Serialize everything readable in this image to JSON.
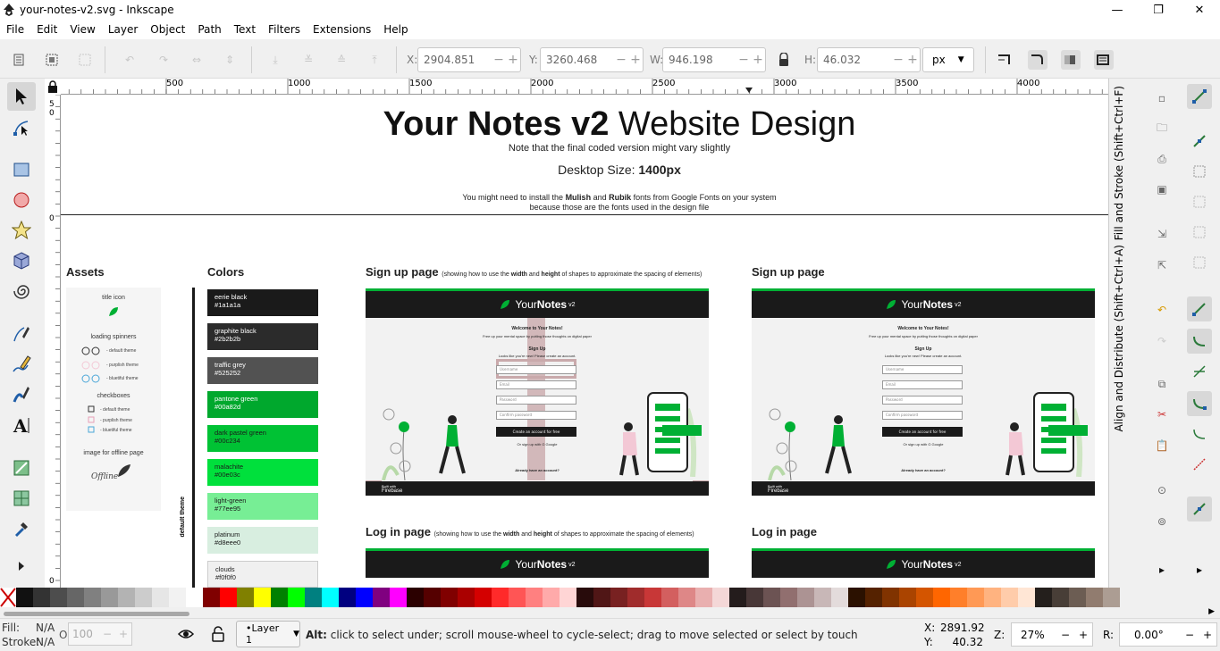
{
  "window": {
    "title": "your-notes-v2.svg - Inkscape",
    "minimize": "—",
    "maximize": "❐",
    "close": "✕"
  },
  "menu": [
    "File",
    "Edit",
    "View",
    "Layer",
    "Object",
    "Path",
    "Text",
    "Filters",
    "Extensions",
    "Help"
  ],
  "toolbar": {
    "x_label": "X:",
    "x_value": "2904.851",
    "y_label": "Y:",
    "y_value": "3260.468",
    "w_label": "W:",
    "w_value": "946.198",
    "h_label": "H:",
    "h_value": "46.032",
    "unit": "px",
    "minus": "−",
    "plus": "+"
  },
  "ruler": {
    "labels": [
      "500",
      "1000",
      "1500",
      "2000",
      "2500",
      "3000",
      "3500",
      "4000"
    ],
    "left_labels": [
      "5",
      "0",
      "0",
      "0"
    ]
  },
  "canvas": {
    "heading_bold": "Your Notes v2",
    "heading_rest": " Website Design",
    "note": "Note that the final coded version might vary slightly",
    "desktop_prefix": "Desktop Size: ",
    "desktop_value": "1400px",
    "fonts_line1_pre": "You might need to install the ",
    "font_a": "Mulish",
    "fonts_and": " and ",
    "font_b": "Rubik",
    "fonts_line1_post": " fonts from Google Fonts on your system",
    "fonts_line2": "because those are the fonts used in the design file",
    "assets_title": "Assets",
    "colors_title": "Colors",
    "assets": {
      "title_icon": "title icon",
      "loading_spinners": "loading spinners",
      "spinner_items": [
        "- default theme",
        "- purplish theme",
        "- bluetiful theme"
      ],
      "checkboxes": "checkboxes",
      "checkbox_items": [
        "- default theme",
        "- purplish theme",
        "- bluetiful theme"
      ],
      "offline_label": "image for offline page",
      "offline_word": "Offline"
    },
    "default_theme_label": "default theme",
    "colors": [
      {
        "name": "eerie black",
        "hex": "#1a1a1a",
        "bg": "#1a1a1a",
        "fg": "#ffffff"
      },
      {
        "name": "graphite black",
        "hex": "#2b2b2b",
        "bg": "#2b2b2b",
        "fg": "#ffffff"
      },
      {
        "name": "traffic grey",
        "hex": "#525252",
        "bg": "#525252",
        "fg": "#ffffff"
      },
      {
        "name": "pantone green",
        "hex": "#00a82d",
        "bg": "#00a82d",
        "fg": "#ffffff"
      },
      {
        "name": "dark pastel green",
        "hex": "#00c234",
        "bg": "#00c234",
        "fg": "#1a1a1a"
      },
      {
        "name": "malachite",
        "hex": "#00e03c",
        "bg": "#00e03c",
        "fg": "#1a1a1a"
      },
      {
        "name": "light-green",
        "hex": "#77ee95",
        "bg": "#77ee95",
        "fg": "#1a1a1a"
      },
      {
        "name": "platinum",
        "hex": "#d8eee0",
        "bg": "#d8eee0",
        "fg": "#1a1a1a"
      },
      {
        "name": "clouds",
        "hex": "#f0f0f0",
        "bg": "#f0f0f0",
        "fg": "#1a1a1a"
      }
    ],
    "signup_title": "Sign up page",
    "login_title": "Log in page",
    "spacing_note_pre": "(showing how to use the ",
    "spacing_width": "width",
    "spacing_and": " and ",
    "spacing_height": "height",
    "spacing_note_post": " of shapes to approximate the spacing of elements)",
    "mock": {
      "brand_pre": "Your ",
      "brand_bold": "Notes",
      "brand_v": " v2",
      "welcome": "Welcome to Your Notes!",
      "tagline": "Free up your mental space by putting those thoughts on digital paper",
      "signup": "Sign Up",
      "new_here": "Looks like you're new! Please create an account.",
      "fields": [
        "Username",
        "Email",
        "Password",
        "Confirm password"
      ],
      "create_btn": "Create an account for free",
      "or_google": "Or sign up with  G  Google",
      "already": "Already have an account?",
      "built_with": "Built with",
      "firebase": "Firebase"
    }
  },
  "status": {
    "fill_label": "Fill:",
    "fill_value": "N/A",
    "stroke_label": "Stroke:",
    "stroke_value": "N/A",
    "opacity_label": "O:",
    "opacity_value": "100",
    "layer": "•Layer 1",
    "message_bold": "Alt:",
    "message": " click to select under; scroll mouse-wheel to cycle-select; drag to move selected or select by touch",
    "x_label": "X:",
    "x_value": "2891.92",
    "y_label": "Y:",
    "y_value": "40.32",
    "z_label": "Z:",
    "zoom": "27%",
    "r_label": "R:",
    "rotation": "0.00°"
  },
  "docks": {
    "fill_stroke": "Fill and Stroke (Shift+Ctrl+F)",
    "align": "Align and Distribute (Shift+Ctrl+A)"
  },
  "palette": [
    "#111111",
    "#333333",
    "#4d4d4d",
    "#666666",
    "#808080",
    "#999999",
    "#b3b3b3",
    "#cccccc",
    "#e6e6e6",
    "#f2f2f2",
    "#ffffff",
    "#800000",
    "#ff0000",
    "#808000",
    "#ffff00",
    "#008000",
    "#00ff00",
    "#008080",
    "#00ffff",
    "#000080",
    "#0000ff",
    "#800080",
    "#ff00ff",
    "#2b0000",
    "#550000",
    "#800000",
    "#aa0000",
    "#d40000",
    "#ff2a2a",
    "#ff5555",
    "#ff8080",
    "#ffaaaa",
    "#ffd5d5",
    "#280b0b",
    "#501616",
    "#782121",
    "#a02c2c",
    "#c83737",
    "#d35f5f",
    "#de8787",
    "#e9afaf",
    "#f4d7d7",
    "#241c1c",
    "#483737",
    "#6c5353",
    "#916f6f",
    "#ac9393",
    "#c8b7b7",
    "#e3dbdb",
    "#2b1100",
    "#552200",
    "#803300",
    "#aa4400",
    "#d45500",
    "#ff6600",
    "#ff7f2a",
    "#ff9955",
    "#ffb380",
    "#ffccaa",
    "#ffe6d5",
    "#241f1c",
    "#483e37",
    "#6c5d53",
    "#917c6f",
    "#ac9d93"
  ]
}
